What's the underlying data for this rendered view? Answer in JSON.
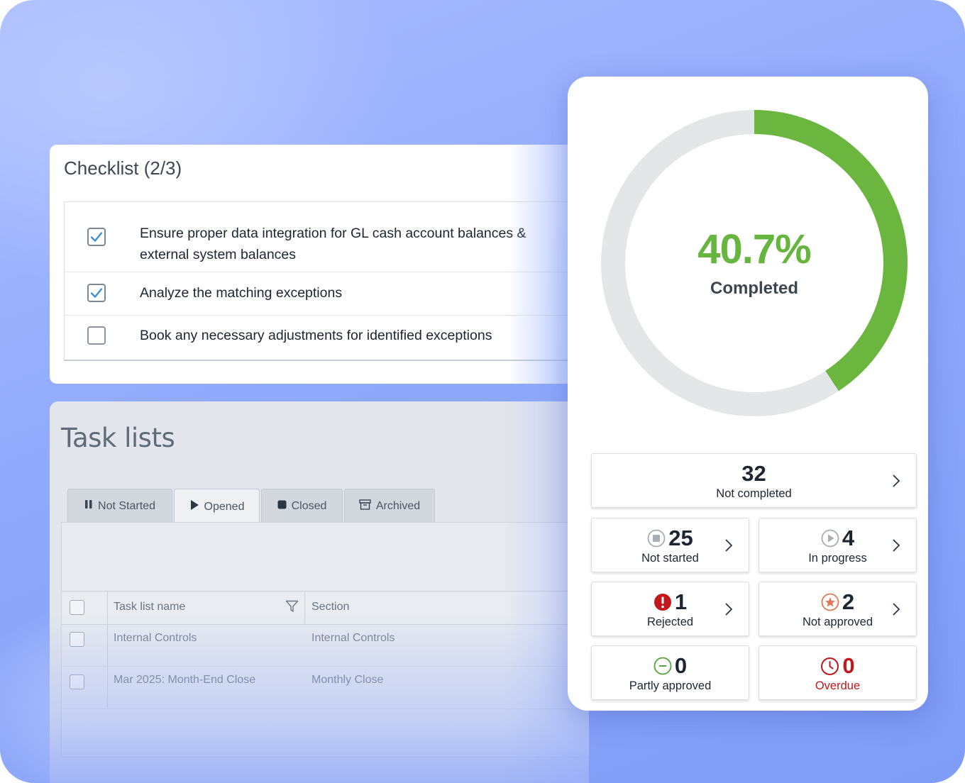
{
  "checklist": {
    "title": "Checklist (2/3)",
    "items": [
      {
        "text_line1": "Ensure proper data integration for GL cash account balances &",
        "text_line2": "external system balances",
        "checked": true
      },
      {
        "text": "Analyze the matching exceptions",
        "checked": true
      },
      {
        "text": "Book any necessary adjustments for identified exceptions",
        "checked": false
      }
    ]
  },
  "task_lists": {
    "title": "Task lists",
    "tabs": [
      {
        "label": "Not Started",
        "icon": "pause-icon",
        "active": false
      },
      {
        "label": "Opened",
        "icon": "play-icon",
        "active": true
      },
      {
        "label": "Closed",
        "icon": "stop-icon",
        "active": false
      },
      {
        "label": "Archived",
        "icon": "archive-icon",
        "active": false
      }
    ],
    "columns": [
      "Task list name",
      "Section"
    ],
    "rows": [
      {
        "name": "Internal Controls",
        "section": "Internal Controls"
      },
      {
        "name": "Mar 2025: Month-End Close",
        "section": "Monthly Close"
      }
    ]
  },
  "progress": {
    "percent_text": "40.7%",
    "percent_value": 40.7,
    "label": "Completed",
    "colors": {
      "complete": "#6ab63f",
      "remaining": "#e4e6e8",
      "overdue": "#c2171d"
    }
  },
  "stats": {
    "not_completed": {
      "value": "32",
      "label": "Not completed"
    },
    "not_started": {
      "value": "25",
      "label": "Not started",
      "icon": "not-started-icon"
    },
    "in_progress": {
      "value": "4",
      "label": "In progress",
      "icon": "in-progress-icon"
    },
    "rejected": {
      "value": "1",
      "label": "Rejected",
      "icon": "rejected-icon"
    },
    "not_approved": {
      "value": "2",
      "label": "Not approved",
      "icon": "not-approved-icon"
    },
    "partly_approved": {
      "value": "0",
      "label": "Partly approved",
      "icon": "partly-approved-icon"
    },
    "overdue": {
      "value": "0",
      "label": "Overdue",
      "icon": "overdue-clock-icon"
    }
  }
}
